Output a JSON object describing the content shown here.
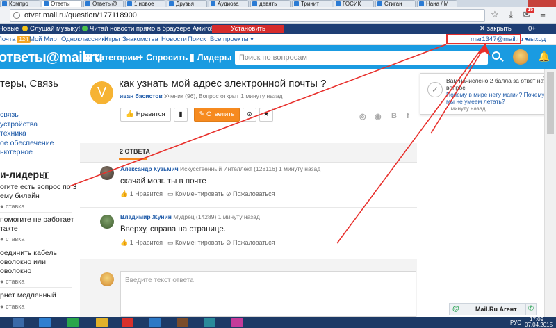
{
  "browser": {
    "tabs": [
      {
        "label": "Компро",
        "active": false
      },
      {
        "label": "Ответы",
        "active": true
      },
      {
        "label": "Ответы@",
        "active": false
      },
      {
        "label": "1 новое",
        "active": false
      },
      {
        "label": "Друзья",
        "active": false
      },
      {
        "label": "Аудиоза",
        "active": false
      },
      {
        "label": "девять",
        "active": false
      },
      {
        "label": "Тринит",
        "active": false
      },
      {
        "label": "ГОСИК",
        "active": false
      },
      {
        "label": "Стиган",
        "active": false
      },
      {
        "label": "Нана / М",
        "active": false
      }
    ],
    "url": "otvet.mail.ru/question/177118900",
    "notif_count": "15"
  },
  "toolbar": {
    "news_left": "Новые",
    "music": "Слушай музыку!",
    "news": "Читай новости прямо в браузере Амиго!",
    "install": "Установить",
    "close": "закрыть",
    "counter": "0+"
  },
  "portal": {
    "mail": "Почта",
    "mail_count": "124",
    "myworld": "Мой Мир",
    "ok": "Одноклассники",
    "games": "Игры",
    "dating": "Знакомства",
    "news": "Новости",
    "search": "Поиск",
    "all_projects": "Все проекты",
    "user_email": "mar1347@mail.ru",
    "logout": "выход"
  },
  "header": {
    "logo": "ответы@mail.ru",
    "categories": "Категории",
    "ask": "Спросить",
    "leaders": "Лидеры",
    "search_placeholder": "Поиск по вопросам"
  },
  "sidebar": {
    "title": "теры, Связь",
    "links": [
      "связь",
      "устройства",
      "техника",
      "ое обеспечение",
      "ьютерное"
    ],
    "leaders_heading": "и-лидеры",
    "questions": [
      {
        "lines": [
          "огите есть вопрос по 3g",
          "ему билайн"
        ],
        "stake": "ставка"
      },
      {
        "lines": [
          "помогите не работает",
          "такте"
        ],
        "stake": "ставка"
      },
      {
        "lines": [
          "оединить кабель",
          "оволокно или",
          "оволокно"
        ],
        "stake": "ставка"
      },
      {
        "lines": [
          "рнет медленный"
        ],
        "stake": "ставка"
      }
    ]
  },
  "question": {
    "avatar_letter": "V",
    "title": "как узнать мой адрес электронной почты ?",
    "author": "иван басистов",
    "meta": "Ученик (96), Вопрос открыт 1 минуту назад",
    "like_label": "Нравится",
    "answer_label": "Ответить",
    "answers_count_label": "2 ОТВЕТА"
  },
  "answers": [
    {
      "author": "Александр Кузьмич",
      "rank": "Искусственный Интеллект (128116)",
      "time": "1 минуту назад",
      "text": "скачай мозг. ты в почте",
      "likes": "1 Нравится",
      "comment": "Комментировать",
      "report": "Пожаловаться"
    },
    {
      "author": "Владимир Жунин",
      "rank": "Мудрец (14289)",
      "time": "1 минуту назад",
      "text": "Вверху, справа на странице.",
      "likes": "1 Нравится",
      "comment": "Комментировать",
      "report": "Пожаловаться"
    }
  ],
  "compose": {
    "placeholder": "Введите текст ответа"
  },
  "notification": {
    "text": "Вам начислено 2 балла за ответ на вопрос",
    "link": "Почему в мире нету магии? Почему мы не умеем летать?",
    "time": "1 минуту назад"
  },
  "agent": {
    "name": "Mail.Ru Агент"
  },
  "taskbar": {
    "lang": "РУС",
    "time": "17:09",
    "date": "07.04.2015"
  },
  "colors": {
    "brand_blue": "#1a9be1",
    "toolbar_navy": "#1e3e74",
    "accent_orange": "#f68a1f",
    "annotation_red": "#e8302c"
  }
}
